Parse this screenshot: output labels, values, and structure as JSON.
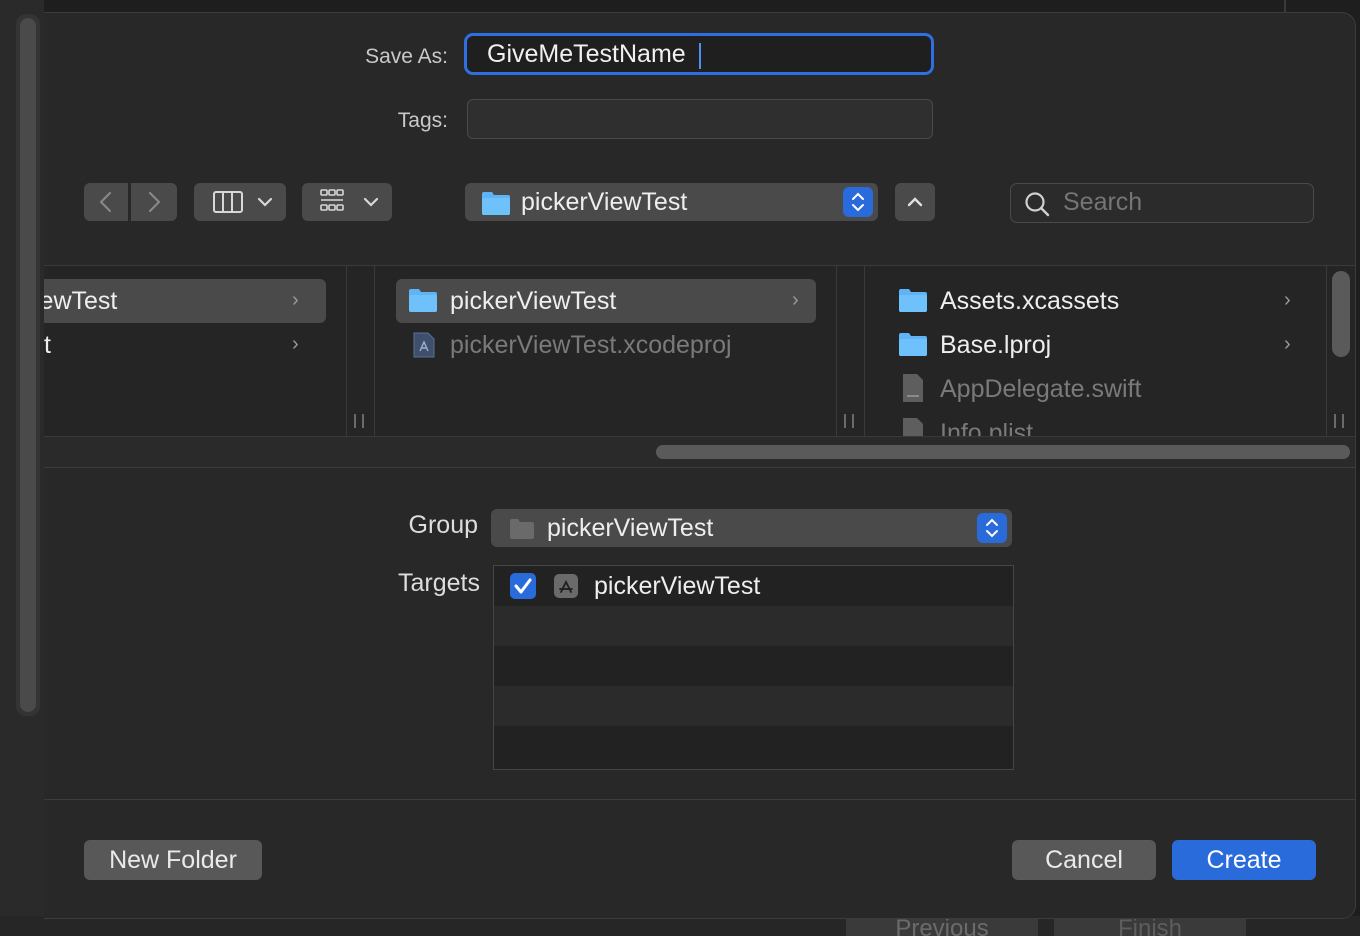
{
  "dialog": {
    "save_as_label": "Save As:",
    "save_as_value": "GiveMeTestName",
    "tags_label": "Tags:",
    "location_popup": "pickerViewTest",
    "search_placeholder": "Search"
  },
  "browser": {
    "column1": [
      {
        "label": "iewTest",
        "selected": true
      },
      {
        "label": "t",
        "selected": false
      }
    ],
    "column2": [
      {
        "label": "pickerViewTest",
        "kind": "folder",
        "selected": true
      },
      {
        "label": "pickerViewTest.xcodeproj",
        "kind": "xcodeproj",
        "dimmed": true
      }
    ],
    "column3": [
      {
        "label": "Assets.xcassets",
        "kind": "folder"
      },
      {
        "label": "Base.lproj",
        "kind": "folder"
      },
      {
        "label": "AppDelegate.swift",
        "kind": "swift",
        "dimmed": true
      },
      {
        "label": "Info.plist",
        "kind": "plist",
        "dimmed": true
      }
    ]
  },
  "options": {
    "group_label": "Group",
    "group_value": "pickerViewTest",
    "targets_label": "Targets",
    "targets": [
      {
        "label": "pickerViewTest",
        "checked": true
      }
    ]
  },
  "buttons": {
    "new_folder": "New Folder",
    "cancel": "Cancel",
    "create": "Create"
  },
  "background": {
    "previous": "Previous",
    "finish": "Finish"
  },
  "colors": {
    "accent": "#2a6bdc",
    "focus_ring": "#2f6fe0",
    "folder": "#5fb4f5"
  }
}
